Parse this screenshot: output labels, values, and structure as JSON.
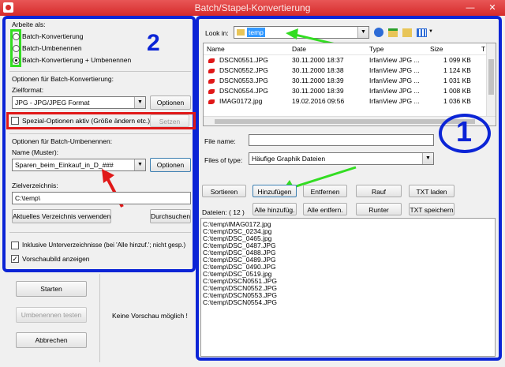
{
  "window": {
    "title": "Batch/Stapel-Konvertierung"
  },
  "left": {
    "mode_label": "Arbeite als:",
    "modes": [
      "Batch-Konvertierung",
      "Batch-Umbenennen",
      "Batch-Konvertierung + Umbenennen"
    ],
    "badge": "2",
    "conv_options_label": "Optionen für Batch-Konvertierung:",
    "target_format_label": "Zielformat:",
    "target_format_value": "JPG - JPG/JPEG Format",
    "options_button": "Optionen",
    "special_options_label": "Spezial-Optionen aktiv (Größe ändern etc.)",
    "set_button": "Setzen",
    "rename_options_label": "Optionen für Batch-Umbenennen:",
    "name_pattern_label": "Name (Muster):",
    "name_pattern_value": "Sparen_beim_Einkauf_in_D_###",
    "rename_options_button": "Optionen",
    "target_dir_label": "Zielverzeichnis:",
    "target_dir_value": "C:\\temp\\",
    "use_current_dir_button": "Aktuelles Verzeichnis verwenden",
    "browse_button": "Durchsuchen",
    "include_subdirs_label": "Inklusive Unterverzeichnisse (bei 'Alle hinzuf.'; nicht gesp.)",
    "show_preview_label": "Vorschaubild anzeigen",
    "start_button": "Starten",
    "test_rename_button": "Umbenennen testen",
    "cancel_button": "Abbrechen",
    "no_preview_text": "Keine Vorschau möglich !"
  },
  "right": {
    "badge": "1",
    "look_in_label": "Look in:",
    "look_in_value": "temp",
    "columns": [
      "Name",
      "Date",
      "Type",
      "Size",
      "T"
    ],
    "files": [
      {
        "name": "DSCN0551.JPG",
        "date": "30.11.2000 18:37",
        "type": "IrfanView JPG ...",
        "size": "1 099 KB"
      },
      {
        "name": "DSCN0552.JPG",
        "date": "30.11.2000 18:38",
        "type": "IrfanView JPG ...",
        "size": "1 124 KB"
      },
      {
        "name": "DSCN0553.JPG",
        "date": "30.11.2000 18:39",
        "type": "IrfanView JPG ...",
        "size": "1 031 KB"
      },
      {
        "name": "DSCN0554.JPG",
        "date": "30.11.2000 18:39",
        "type": "IrfanView JPG ...",
        "size": "1 008 KB"
      },
      {
        "name": "IMAG0172.jpg",
        "date": "19.02.2016 09:56",
        "type": "IrfanView JPG ...",
        "size": "1 036 KB"
      }
    ],
    "file_name_label": "File name:",
    "file_name_value": "",
    "files_of_type_label": "Files of type:",
    "files_of_type_value": "Häufige Graphik Dateien",
    "sort_button": "Sortieren",
    "add_button": "Hinzufügen",
    "remove_button": "Entfernen",
    "up_button": "Rauf",
    "load_txt_button": "TXT laden",
    "files_count_label": "Dateien: ( 12 )",
    "add_all_button": "Alle hinzufüg.",
    "remove_all_button": "Alle entfern.",
    "down_button": "Runter",
    "save_txt_button": "TXT speichern",
    "input_files": [
      "C:\\temp\\IMAG0172.jpg",
      "C:\\temp\\DSC_0234.jpg",
      "C:\\temp\\DSC_0465.jpg",
      "C:\\temp\\DSC_0487.JPG",
      "C:\\temp\\DSC_0488.JPG",
      "C:\\temp\\DSC_0489.JPG",
      "C:\\temp\\DSC_0490.JPG",
      "C:\\temp\\DSC_0519.jpg",
      "C:\\temp\\DSCN0551.JPG",
      "C:\\temp\\DSCN0552.JPG",
      "C:\\temp\\DSCN0553.JPG",
      "C:\\temp\\DSCN0554.JPG"
    ]
  },
  "colors": {
    "annotation_blue": "#0b24d6",
    "annotation_green": "#33dd22",
    "annotation_red": "#e01818",
    "title_bar": "#d62b2b"
  }
}
